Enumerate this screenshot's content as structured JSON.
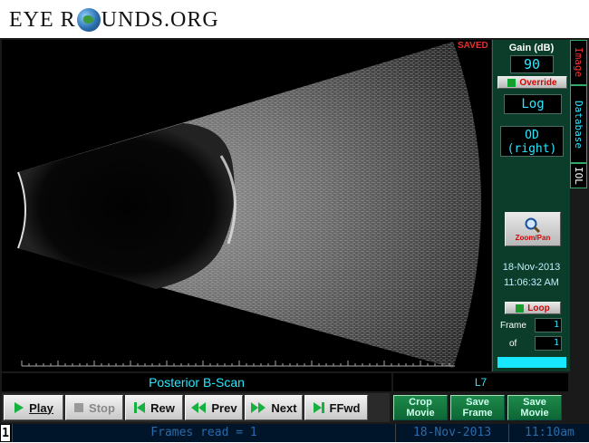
{
  "logo": {
    "prefix": "EYE R",
    "suffix": "UNDS.ORG"
  },
  "status": {
    "saved": "SAVED"
  },
  "right_panel": {
    "gain_label": "Gain (dB)",
    "gain_value": "90",
    "override_label": "Override",
    "scale_mode": "Log",
    "eye_line1": "OD",
    "eye_line2": "(right)",
    "zoom_label": "Zoom/Pan",
    "date": "18-Nov-2013",
    "time": "11:06:32 AM",
    "loop_label": "Loop",
    "frame_label": "Frame",
    "frame_value": "1",
    "of_label": "of",
    "of_value": "1"
  },
  "tabs": [
    {
      "label": "Image",
      "color": "#ff3030"
    },
    {
      "label": "Database",
      "color": "#27e7ff"
    },
    {
      "label": "IOL",
      "color": "#ffffff"
    }
  ],
  "scan": {
    "mode_label": "Posterior B-Scan",
    "probe_label": "L7"
  },
  "toolbar": {
    "play": "Play",
    "stop": "Stop",
    "rew": "Rew",
    "prev": "Prev",
    "next": "Next",
    "ffwd": "FFwd"
  },
  "movie_buttons": {
    "crop": [
      "Crop",
      "Movie"
    ],
    "save_frame": [
      "Save",
      "Frame"
    ],
    "save_movie": [
      "Save",
      "Movie"
    ]
  },
  "statusbar": {
    "index": "1",
    "frames_read": "Frames read = 1",
    "date": "18-Nov-2013",
    "time": "11:10am"
  }
}
